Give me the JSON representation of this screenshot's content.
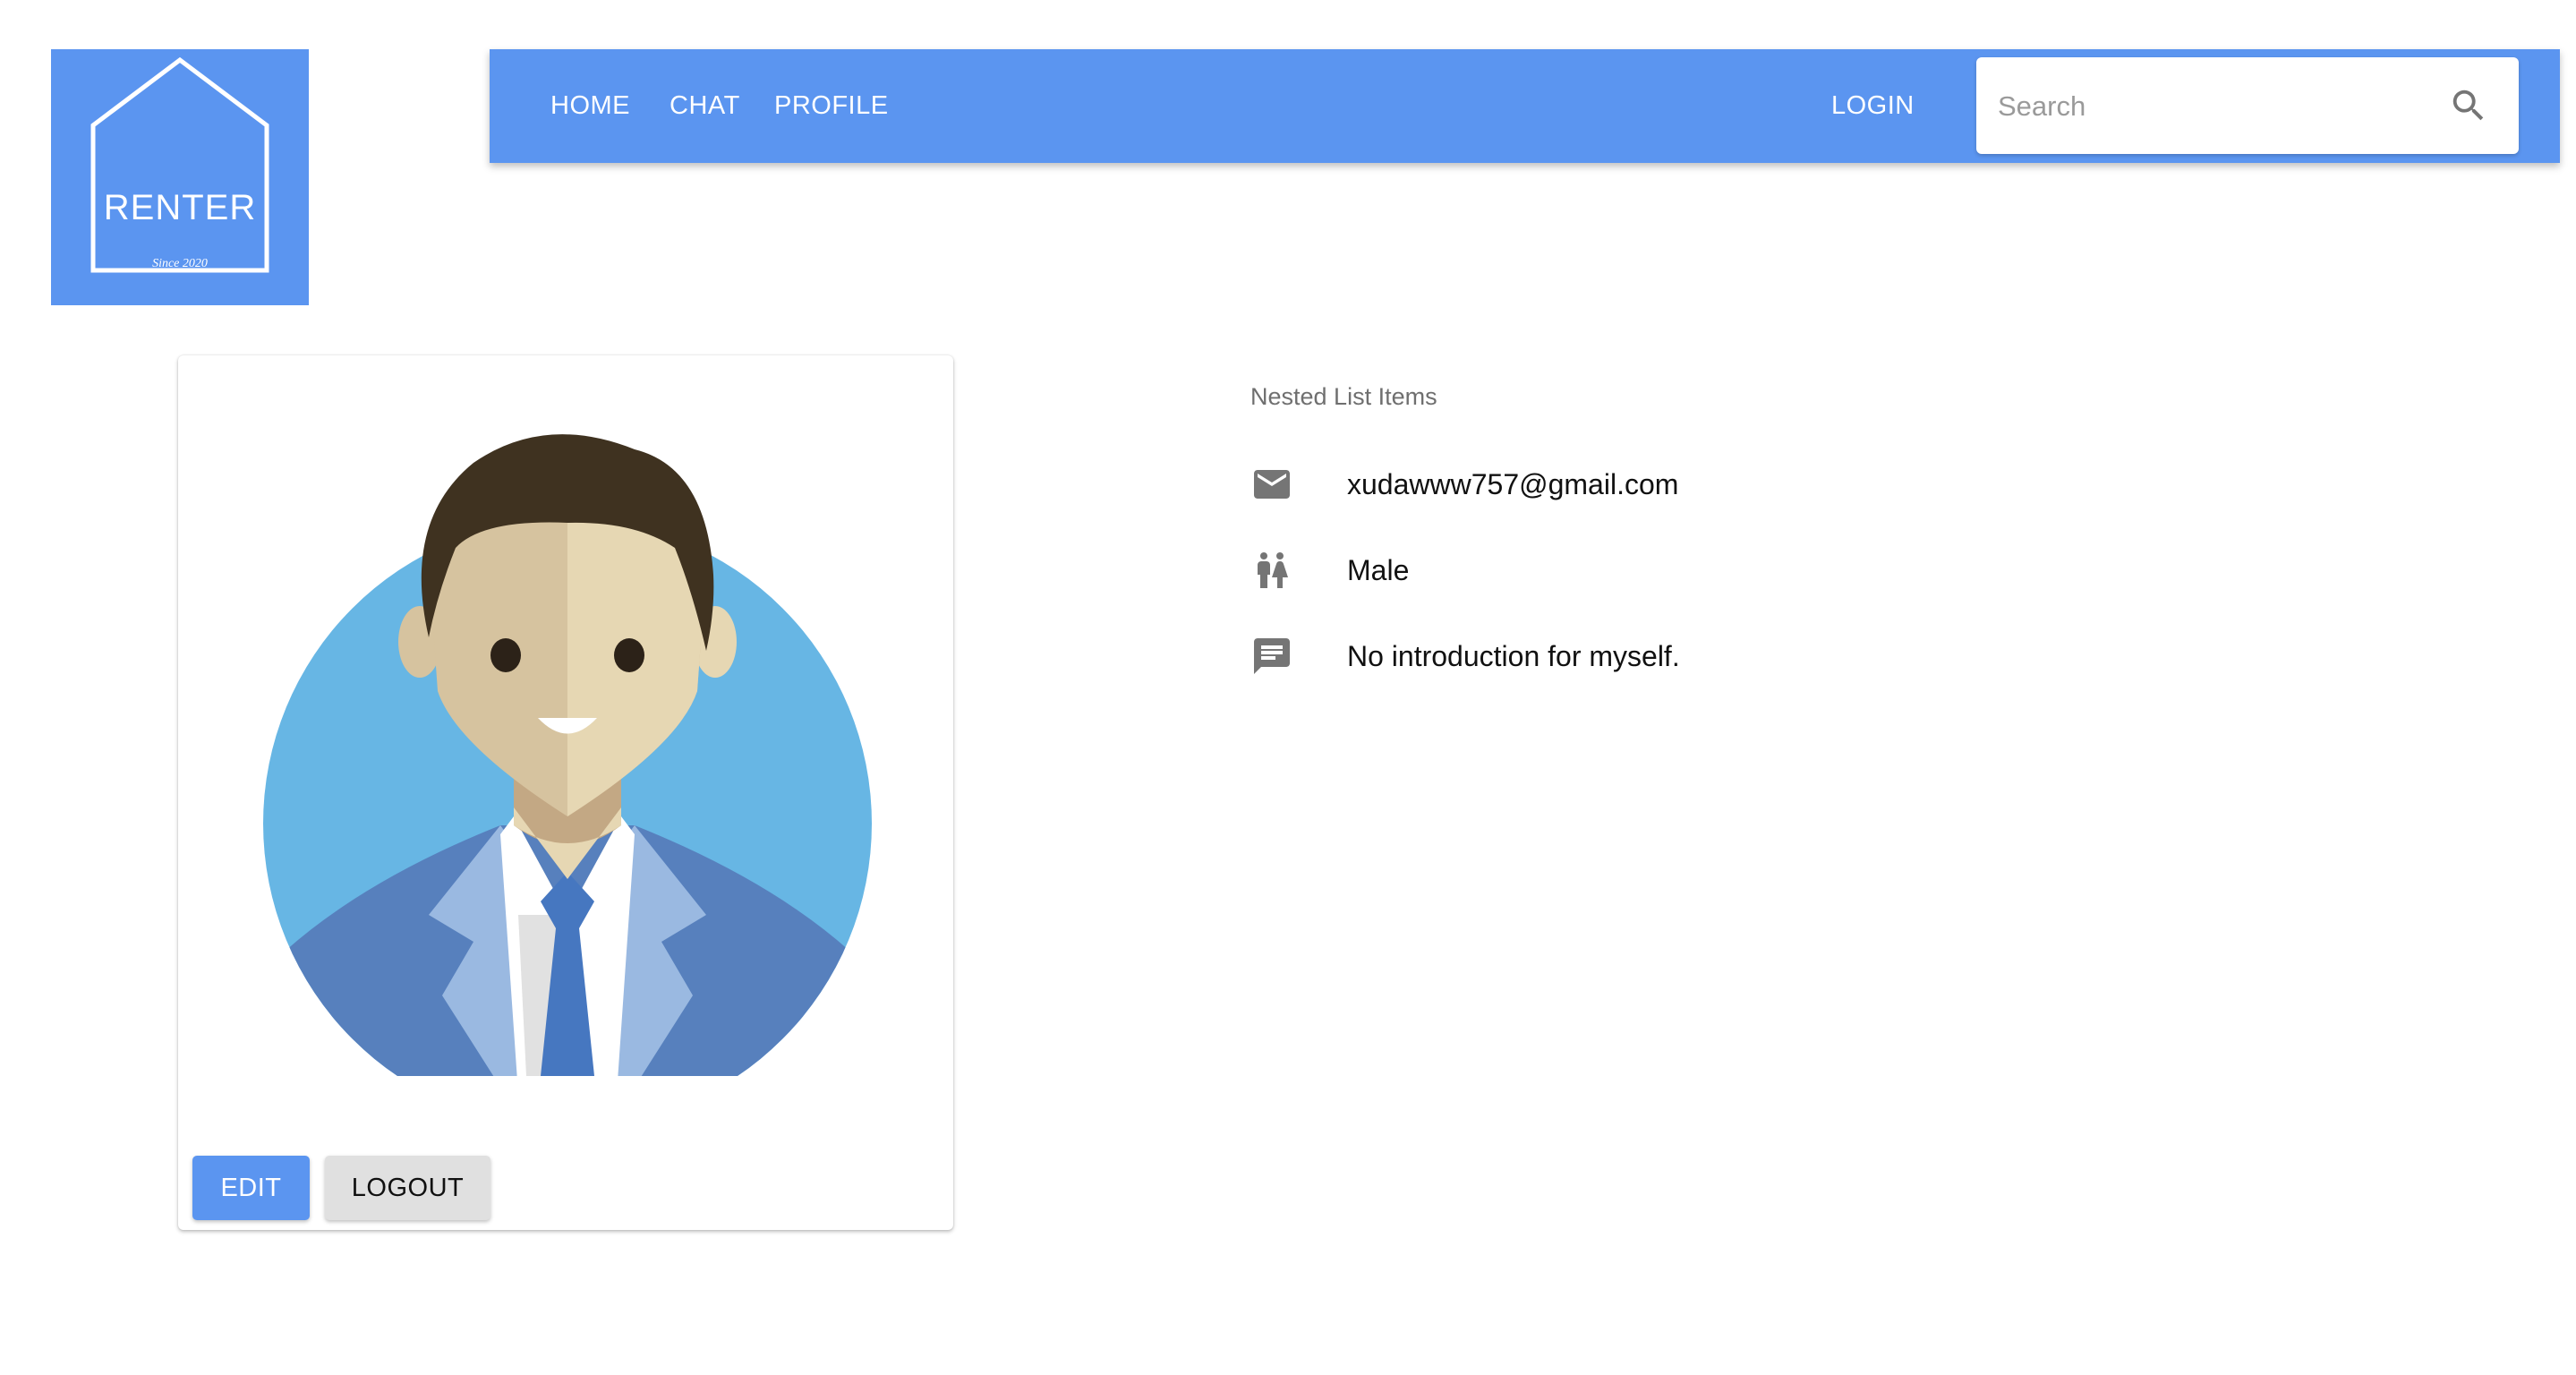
{
  "logo": {
    "name": "RENTER",
    "since": "Since 2020"
  },
  "nav": {
    "home": "HOME",
    "chat": "CHAT",
    "profile": "PROFILE",
    "login": "LOGIN"
  },
  "search": {
    "placeholder": "Search",
    "value": ""
  },
  "profile_card": {
    "edit_label": "EDIT",
    "logout_label": "LOGOUT"
  },
  "info_list": {
    "header": "Nested List Items",
    "items": [
      {
        "icon": "mail-icon",
        "text": "xudawww757@gmail.com"
      },
      {
        "icon": "gender-icon",
        "text": "Male"
      },
      {
        "icon": "message-icon",
        "text": "No introduction for myself."
      }
    ]
  },
  "colors": {
    "primary": "#5b95f0",
    "avatar_bg": "#67b6e4",
    "logout_bg": "#e0e0e0"
  }
}
